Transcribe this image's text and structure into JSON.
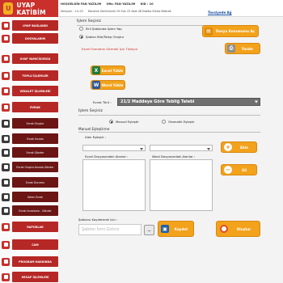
{
  "app": {
    "title": "UYAP KATİBİM",
    "logo_glyph": "U",
    "user_line": [
      "HOŞGELDİN FAN YAZILIM",
      "Ofis: FAN YAZILIM",
      "KID : 10"
    ],
    "version_line": [
      "Versiyon : 1.0.23",
      "Deneme Sürümünün 29 Gün 23 Saat 48 Dakika Süresi Bitecek"
    ],
    "feedback_link": "Tavsiyede Ağ"
  },
  "sidebar": {
    "items": [
      {
        "label": "UYAP BAĞLANDI",
        "icon": "plug-icon",
        "icon_color": "#c9302c",
        "sub": false
      },
      {
        "label": "DOSYALARIM",
        "icon": "folder-icon",
        "icon_color": "#c9302c",
        "sub": false
      },
      {
        "label": "UYAP YAMICİSORGU",
        "icon": "search-icon",
        "icon_color": "#c9302c",
        "sub": false
      },
      {
        "label": "TOPLU İŞLEMLER",
        "icon": "list-icon",
        "icon_color": "#c9302c",
        "sub": false
      },
      {
        "label": "VEKALET İŞLEMLERİ",
        "icon": "document-icon",
        "icon_color": "#c9302c",
        "sub": false
      },
      {
        "label": "EVRAK",
        "icon": "file-icon",
        "icon_color": "#c9302c",
        "sub": false
      },
      {
        "label": "Evrak Oluştur",
        "icon": "pencil-icon",
        "icon_color": "#3a3a3a",
        "sub": true
      },
      {
        "label": "Evrak İmzala",
        "icon": "pen-icon",
        "icon_color": "#3a3a3a",
        "sub": true
      },
      {
        "label": "Evrak Gönder",
        "icon": "send-icon",
        "icon_color": "#3a3a3a",
        "sub": true
      },
      {
        "label": "Evrak Oluştur-İmzala-Gönder",
        "icon": "stack-icon",
        "icon_color": "#3a3a3a",
        "sub": true
      },
      {
        "label": "Evrak Durumu",
        "icon": "status-icon",
        "icon_color": "#3a3a3a",
        "sub": true
      },
      {
        "label": "Gelen Evrak",
        "icon": "inbox-icon",
        "icon_color": "#3a3a3a",
        "sub": true
      },
      {
        "label": "Evrak İmzalama - Gönder",
        "icon": "signature-icon",
        "icon_color": "#3a3a3a",
        "sub": true
      },
      {
        "label": "RAPORLAR",
        "icon": "chart-icon",
        "icon_color": "#c9302c",
        "sub": false
      },
      {
        "label": "CAM",
        "icon": "camera-icon",
        "icon_color": "#c9302c",
        "sub": false
      },
      {
        "label": "PROGRAM HAKKINDA",
        "icon": "info-icon",
        "icon_color": "#c9302c",
        "sub": false
      },
      {
        "label": "HESAP İŞLEMLERİ",
        "icon": "user-icon",
        "icon_color": "#c9302c",
        "sub": false
      }
    ]
  },
  "main": {
    "islem_title": "İşlem Seçiniz",
    "radio_blank": "Ekli Şablonda İşlem Yap",
    "radio_template": "Şablon Bile/Talep Oluştur",
    "warning": "Excel Formatını Görmek İçin Tıklayın",
    "btn_dosya": "Dosya Konumunu Aç",
    "btn_yazdir": "Yazdır",
    "btn_excel": "Excel Yükle",
    "btn_word": "Word Yükle",
    "evrak_turu_label": "Evrak Türü :",
    "evrak_turu_value": "21/2 Maddeye Göre Tebliğ Talebi",
    "islem2_title": "İşlem Seçiniz",
    "radio_manuel": "Manuel Eşleştir",
    "radio_otomatik": "Otomatik Eşleştir",
    "manuel_title": "Manuel Eşleştirme",
    "alan_label": "Alan Eşleştir :",
    "excel_list_label": "Excel Dosyasındaki Alanlar :",
    "word_list_label": "Word Dosyasındaki Alanlar :",
    "btn_ekle": "Ekle",
    "btn_sil": "Sil",
    "sablon_label": "Şablonu Kaydetmek İçin :",
    "sablon_placeholder": "Şablon İsmi Giriniz",
    "btn_kaydet": "Kaydet",
    "btn_olustur": "Oluştur",
    "colors": {
      "accent": "#c9302c",
      "button": "#f2a21b",
      "select": "#6f6f6f",
      "warning": "#d0261c"
    }
  }
}
